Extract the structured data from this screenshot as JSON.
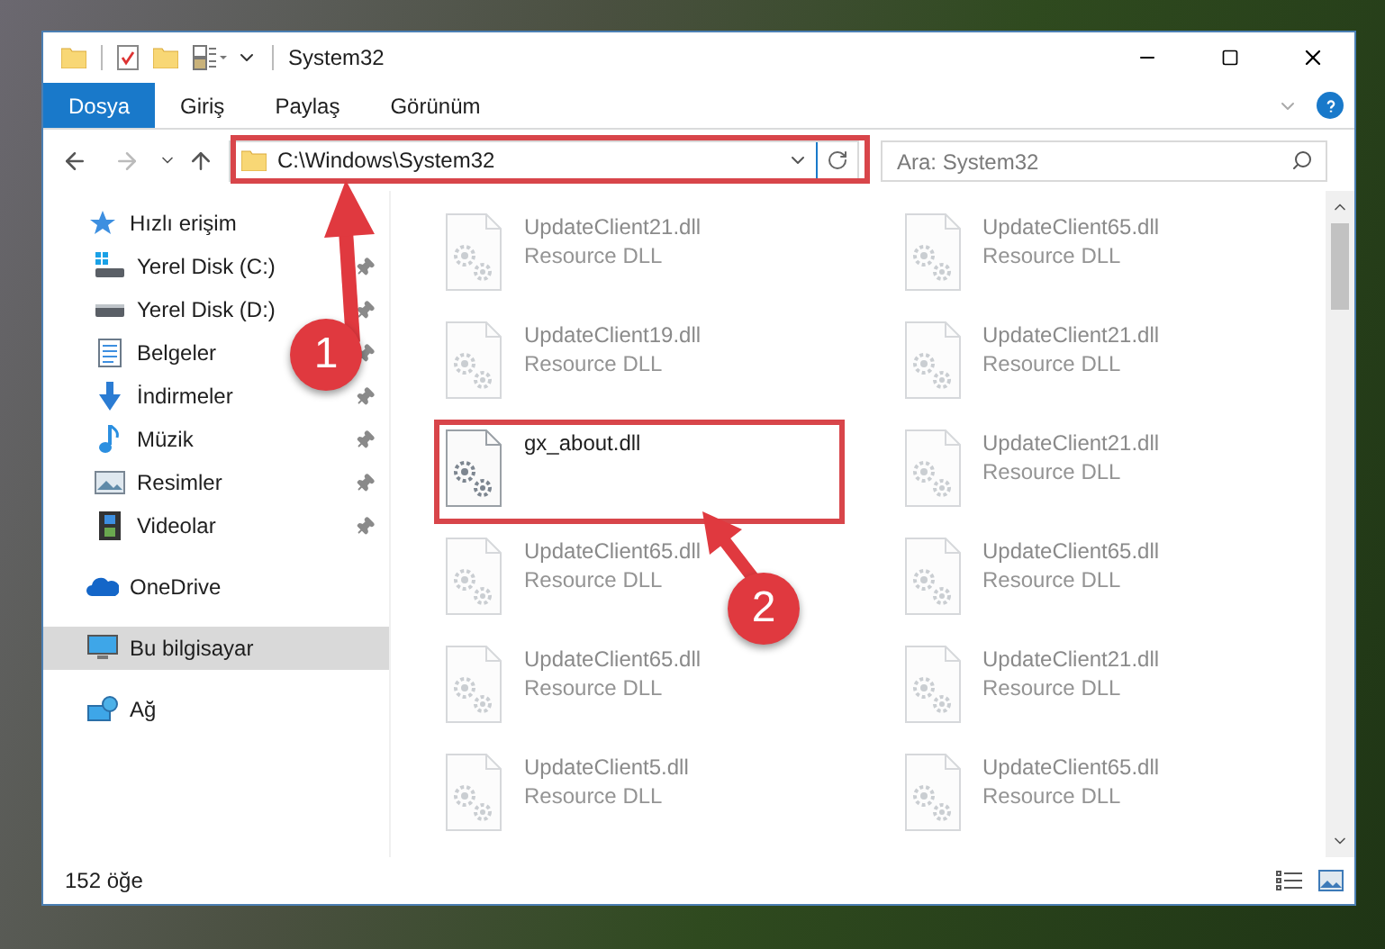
{
  "window": {
    "title": "System32"
  },
  "ribbon": {
    "tabs": [
      {
        "label": "Dosya",
        "selected": true
      },
      {
        "label": "Giriş",
        "selected": false
      },
      {
        "label": "Paylaş",
        "selected": false
      },
      {
        "label": "Görünüm",
        "selected": false
      }
    ]
  },
  "address": {
    "path": "C:\\Windows\\System32"
  },
  "search": {
    "placeholder": "Ara: System32"
  },
  "sidebar": {
    "items": [
      {
        "label": "Hızlı erişim",
        "kind": "star",
        "selected": false,
        "children": [
          {
            "label": "Yerel Disk (C:)",
            "kind": "system-drive",
            "pinned": true
          },
          {
            "label": "Yerel Disk (D:)",
            "kind": "drive",
            "pinned": true
          },
          {
            "label": "Belgeler",
            "kind": "documents",
            "pinned": true
          },
          {
            "label": "İndirmeler",
            "kind": "downloads",
            "pinned": true
          },
          {
            "label": "Müzik",
            "kind": "music",
            "pinned": true
          },
          {
            "label": "Resimler",
            "kind": "pictures",
            "pinned": true
          },
          {
            "label": "Videolar",
            "kind": "videos",
            "pinned": true
          }
        ]
      },
      {
        "label": "OneDrive",
        "kind": "cloud",
        "selected": false
      },
      {
        "label": "Bu bilgisayar",
        "kind": "computer",
        "selected": true
      },
      {
        "label": "Ağ",
        "kind": "network",
        "selected": false
      }
    ]
  },
  "files": [
    {
      "name": "UpdateClient21.dll",
      "type": "Resource DLL",
      "faded": true
    },
    {
      "name": "UpdateClient65.dll",
      "type": "Resource DLL",
      "faded": true
    },
    {
      "name": "UpdateClient19.dll",
      "type": "Resource DLL",
      "faded": true
    },
    {
      "name": "UpdateClient21.dll",
      "type": "Resource DLL",
      "faded": true
    },
    {
      "name": "gx_about.dll",
      "faded": false
    },
    {
      "name": "UpdateClient21.dll",
      "type": "Resource DLL",
      "faded": true
    },
    {
      "name": "UpdateClient65.dll",
      "type": "Resource DLL",
      "faded": true
    },
    {
      "name": "UpdateClient65.dll",
      "type": "Resource DLL",
      "faded": true
    },
    {
      "name": "UpdateClient65.dll",
      "type": "Resource DLL",
      "faded": true
    },
    {
      "name": "UpdateClient21.dll",
      "type": "Resource DLL",
      "faded": true
    },
    {
      "name": "UpdateClient5.dll",
      "type": "Resource DLL",
      "faded": true
    },
    {
      "name": "UpdateClient65.dll",
      "type": "Resource DLL",
      "faded": true
    }
  ],
  "status_bar": {
    "count": "152 öğe"
  },
  "annotations": [
    {
      "number": "1"
    },
    {
      "number": "2"
    }
  ]
}
